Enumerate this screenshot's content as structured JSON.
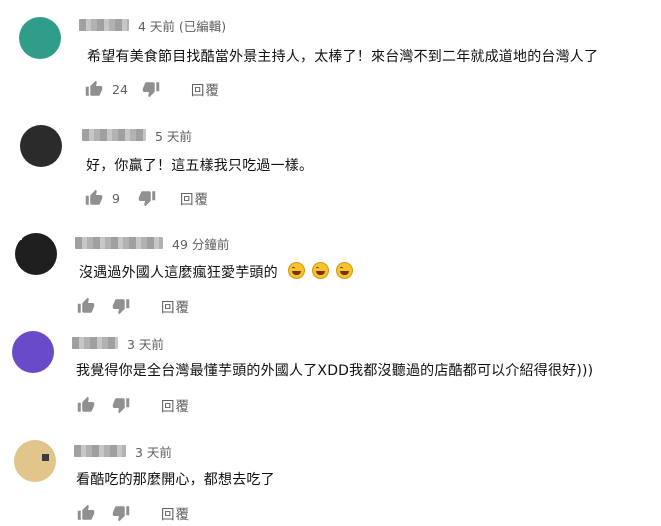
{
  "comments": [
    {
      "time": "4 天前 (已編輯)",
      "text": "希望有美食節目找酷當外景主持人，太棒了！來台灣不到二年就成道地的台灣人了",
      "likes": "24",
      "reply_label": "回覆",
      "avatar_colors": [
        "#2f9d8a",
        "#5dbfa8",
        "#bfe3d9",
        "#3a8f80"
      ]
    },
    {
      "time": "5 天前",
      "text": "好，你贏了！這五樣我只吃過一樣。",
      "likes": "9",
      "reply_label": "回覆",
      "avatar_colors": [
        "#2b2b2b",
        "#6d6d6d",
        "#c9c9c9",
        "#4a4a4a"
      ]
    },
    {
      "time": "49 分鐘前",
      "text": "沒遇過外國人這麼瘋狂愛芋頭的",
      "emoji": [
        "grinning-face-icon",
        "grinning-face-icon",
        "grinning-face-icon"
      ],
      "likes": "",
      "reply_label": "回覆",
      "avatar_colors": [
        "#1f1f1f",
        "#7a5a4a",
        "#d8d0cc",
        "#3d3d3d"
      ]
    },
    {
      "time": "3 天前",
      "text": "我覺得你是全台灣最懂芋頭的外國人了XDD我都沒聽過的店酷都可以介紹得很好)))",
      "likes": "",
      "reply_label": "回覆",
      "avatar_colors": [
        "#6a4bc7",
        "#8d6fd9",
        "#b9a6ea",
        "#5a3cb4"
      ]
    },
    {
      "time": "3 天前",
      "text": "看酷吃的那麼開心，都想去吃了",
      "likes": "",
      "reply_label": "回覆",
      "avatar_colors": [
        "#e1c58a",
        "#3b3b3b",
        "#9a8f7a",
        "#f0e3c0"
      ]
    }
  ]
}
